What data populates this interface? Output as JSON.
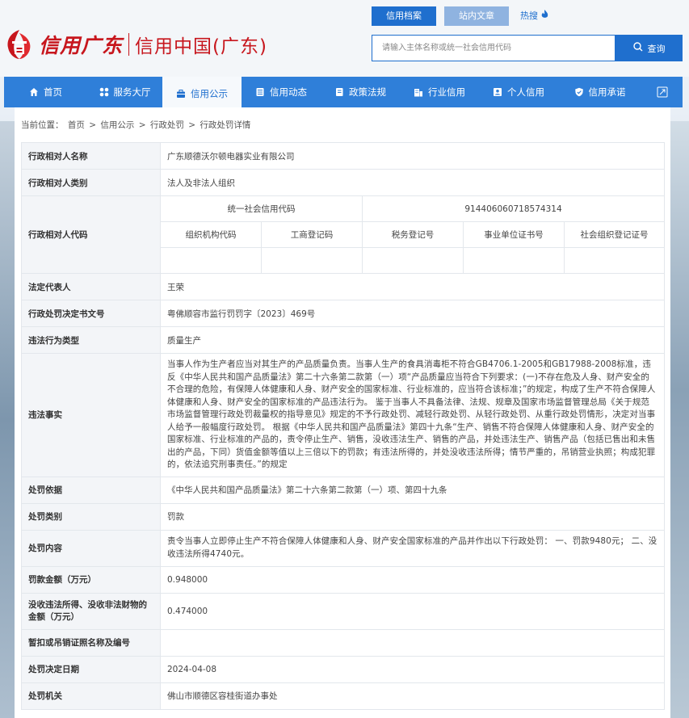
{
  "header": {
    "logo_text_red": "信用广东",
    "logo_text_china": "信用中国(广东)",
    "top_tabs": [
      {
        "label": "信用档案",
        "active": true
      },
      {
        "label": "站内文章",
        "active": false
      },
      {
        "label": "热搜",
        "active": false
      }
    ],
    "search": {
      "placeholder": "请输入主体名称或统一社会信用代码",
      "button_label": "查询"
    }
  },
  "nav": {
    "items": [
      {
        "label": "首页",
        "icon": "home-icon"
      },
      {
        "label": "服务大厅",
        "icon": "grid-icon"
      },
      {
        "label": "信用公示",
        "icon": "briefcase-icon",
        "active": true
      },
      {
        "label": "信用动态",
        "icon": "list-icon"
      },
      {
        "label": "政策法规",
        "icon": "book-icon"
      },
      {
        "label": "行业信用",
        "icon": "building-icon"
      },
      {
        "label": "个人信用",
        "icon": "id-card-icon"
      },
      {
        "label": "信用承诺",
        "icon": "shield-icon"
      }
    ]
  },
  "breadcrumb": {
    "prefix": "当前位置：",
    "items": [
      "首页",
      "信用公示",
      "行政处罚",
      "行政处罚详情"
    ],
    "sep": ">"
  },
  "record": {
    "name_label": "行政相对人名称",
    "name_value": "广东顺德沃尔顿电器实业有限公司",
    "type_label": "行政相对人类别",
    "type_value": "法人及非法人组织",
    "code_label": "行政相对人代码",
    "uscc_label": "统一社会信用代码",
    "uscc_value": "914406060718574314",
    "org_code_label": "组织机构代码",
    "biz_reg_label": "工商登记码",
    "tax_reg_label": "税务登记号",
    "inst_cert_label": "事业单位证书号",
    "social_org_label": "社会组织登记证号",
    "legal_rep_label": "法定代表人",
    "legal_rep_value": "王荣",
    "doc_no_label": "行政处罚决定书文号",
    "doc_no_value": "粤佛顺容市监行罚罚字〔2023〕469号",
    "violation_type_label": "违法行为类型",
    "violation_type_value": "质量生产",
    "facts_label": "违法事实",
    "facts_value": "当事人作为生产者应当对其生产的产品质量负责。当事人生产的食具消毒柜不符合GB4706.1-2005和GB17988-2008标准，违反《中华人民共和国产品质量法》第二十六条第二款第（一）项“产品质量应当符合下列要求：(一)不存在危及人身、财产安全的不合理的危险，有保障人体健康和人身、财产安全的国家标准、行业标准的，应当符合该标准；”的规定，构成了生产不符合保障人体健康和人身、财产安全的国家标准的产品违法行为。 鉴于当事人不具备法律、法规、规章及国家市场监督管理总局《关于规范市场监督管理行政处罚裁量权的指导意见》规定的不予行政处罚、减轻行政处罚、从轻行政处罚、从重行政处罚情形，决定对当事人给予一般幅度行政处罚。 根据《中华人民共和国产品质量法》第四十九条“生产、销售不符合保障人体健康和人身、财产安全的国家标准、行业标准的产品的，责令停止生产、销售，没收违法生产、销售的产品，并处违法生产、销售产品（包括已售出和未售出的产品，下同）货值金额等值以上三倍以下的罚款；有违法所得的，并处没收违法所得；情节严重的，吊销营业执照；构成犯罪的，依法追究刑事责任。”的规定",
    "basis_label": "处罚依据",
    "basis_value": "《中华人民共和国产品质量法》第二十六条第二款第（一）项、第四十九条",
    "category_label": "处罚类别",
    "category_value": "罚款",
    "content_label": "处罚内容",
    "content_value": "责令当事人立即停止生产不符合保障人体健康和人身、财产安全国家标准的产品并作出以下行政处罚： 一、罚款9480元； 二、没收违法所得4740元。",
    "fine_label": "罚款金额（万元）",
    "fine_value": "0.948000",
    "confiscated_label": "没收违法所得、没收非法财物的金额（万元）",
    "confiscated_value": "0.474000",
    "license_label": "暂扣或吊销证照名称及编号",
    "license_value": "",
    "decision_date_label": "处罚决定日期",
    "decision_date_value": "2024-04-08",
    "authority_label": "处罚机关",
    "authority_value": "佛山市顺德区容桂街道办事处"
  },
  "colors": {
    "brand_red": "#c7161d",
    "primary_blue": "#1f6fce",
    "nav_blue": "#2f7fd9"
  }
}
